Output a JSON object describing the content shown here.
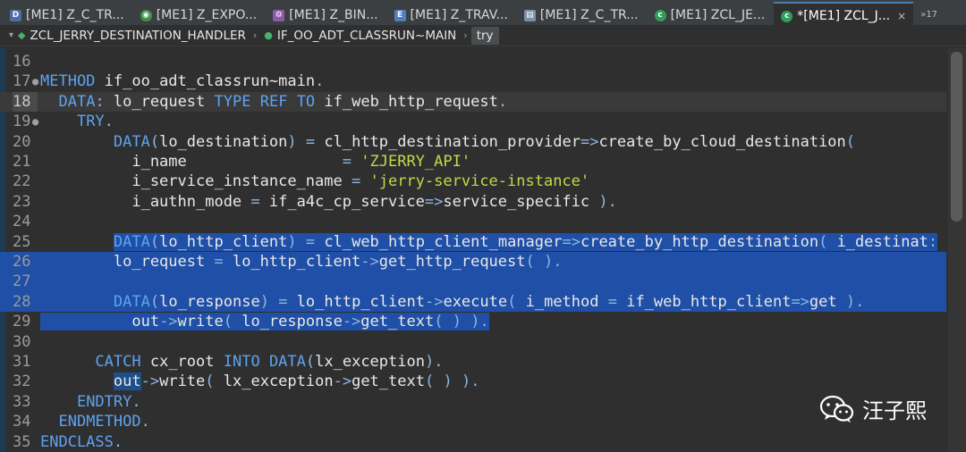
{
  "tabs": [
    {
      "icon": "D",
      "label": "[ME1] Z_C_TR...",
      "active": false
    },
    {
      "icon": "cds",
      "label": "[ME1] Z_EXPO...",
      "active": false
    },
    {
      "icon": "bin",
      "label": "[ME1] Z_BIN...",
      "active": false
    },
    {
      "icon": "E",
      "label": "[ME1] Z_TRAV...",
      "active": false
    },
    {
      "icon": "tbl",
      "label": "[ME1] Z_C_TR...",
      "active": false
    },
    {
      "icon": "cls",
      "label": "[ME1] ZCL_JE...",
      "active": false
    },
    {
      "icon": "cls",
      "label": "*[ME1] ZCL_J...",
      "active": true,
      "close": "×"
    }
  ],
  "tab_overflow": "»17",
  "breadcrumb": {
    "class": "ZCL_JERRY_DESTINATION_HANDLER",
    "method": "IF_OO_ADT_CLASSRUN~MAIN",
    "block": "try"
  },
  "editor": {
    "lines": [
      {
        "n": "16",
        "text": ""
      },
      {
        "n": "17",
        "text": "METHOD if_oo_adt_classrun~main."
      },
      {
        "n": "18",
        "text": "  DATA: lo_request TYPE REF TO if_web_http_request."
      },
      {
        "n": "19",
        "text": "    TRY."
      },
      {
        "n": "20",
        "text": "        DATA(lo_destination) = cl_http_destination_provider=>create_by_cloud_destination("
      },
      {
        "n": "21",
        "text": "          i_name                 = 'ZJERRY_API'"
      },
      {
        "n": "22",
        "text": "          i_service_instance_name = 'jerry-service-instance'"
      },
      {
        "n": "23",
        "text": "          i_authn_mode = if_a4c_cp_service=>service_specific )."
      },
      {
        "n": "24",
        "text": ""
      },
      {
        "n": "25",
        "text": "        DATA(lo_http_client) = cl_web_http_client_manager=>create_by_http_destination( i_destinat:"
      },
      {
        "n": "26",
        "text": "        lo_request = lo_http_client->get_http_request( )."
      },
      {
        "n": "27",
        "text": ""
      },
      {
        "n": "28",
        "text": "        DATA(lo_response) = lo_http_client->execute( i_method = if_web_http_client=>get )."
      },
      {
        "n": "29",
        "text": "          out->write( lo_response->get_text( ) )."
      },
      {
        "n": "30",
        "text": ""
      },
      {
        "n": "31",
        "text": "      CATCH cx_root INTO DATA(lx_exception)."
      },
      {
        "n": "32",
        "text": "        out->write( lx_exception->get_text( ) )."
      },
      {
        "n": "33",
        "text": "    ENDTRY."
      },
      {
        "n": "34",
        "text": "  ENDMETHOD."
      },
      {
        "n": "35",
        "text": "ENDCLASS."
      }
    ]
  },
  "watermark": {
    "text": "汪子熙",
    "icon": "wechat-icon"
  },
  "colors": {
    "keyword": "#5ea2f0",
    "string": "#c2d94a",
    "selection": "#1f4fa6",
    "background": "#2f2f2f"
  }
}
